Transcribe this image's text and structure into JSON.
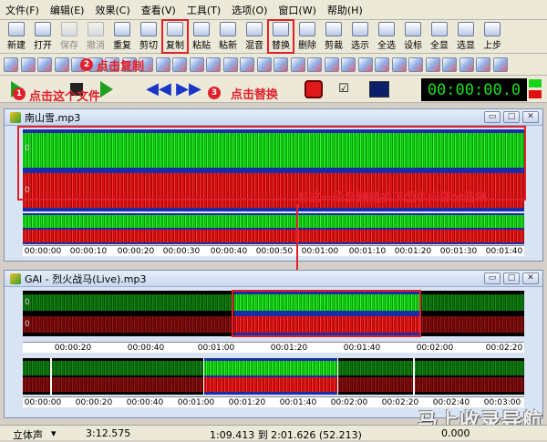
{
  "menu": [
    "文件(F)",
    "编辑(E)",
    "效果(C)",
    "查看(V)",
    "工具(T)",
    "选项(O)",
    "窗口(W)",
    "帮助(H)"
  ],
  "toolbar": [
    {
      "label": "新建",
      "icon": "new-file-icon",
      "disabled": false
    },
    {
      "label": "打开",
      "icon": "open-folder-icon",
      "disabled": false
    },
    {
      "label": "保存",
      "icon": "save-icon",
      "disabled": true
    },
    {
      "label": "撤消",
      "icon": "undo-icon",
      "disabled": true
    },
    {
      "label": "重复",
      "icon": "redo-icon",
      "disabled": false
    },
    {
      "label": "剪切",
      "icon": "cut-icon",
      "disabled": false
    },
    {
      "label": "复制",
      "icon": "copy-icon",
      "disabled": false,
      "highlight": true
    },
    {
      "label": "粘贴",
      "icon": "paste-icon",
      "disabled": false
    },
    {
      "label": "粘新",
      "icon": "paste-new-icon",
      "disabled": false
    },
    {
      "label": "混音",
      "icon": "mix-icon",
      "disabled": false
    },
    {
      "label": "替换",
      "icon": "replace-icon",
      "disabled": false,
      "highlight": true
    },
    {
      "label": "删除",
      "icon": "delete-icon",
      "disabled": false
    },
    {
      "label": "剪裁",
      "icon": "trim-icon",
      "disabled": false
    },
    {
      "label": "选示",
      "icon": "show-selection-icon",
      "disabled": false
    },
    {
      "label": "全选",
      "icon": "select-all-icon",
      "disabled": false
    },
    {
      "label": "设标",
      "icon": "set-marker-icon",
      "disabled": false
    },
    {
      "label": "全显",
      "icon": "zoom-all-icon",
      "disabled": false
    },
    {
      "label": "选显",
      "icon": "zoom-selection-icon",
      "disabled": false
    },
    {
      "label": "上步",
      "icon": "previous-step-icon",
      "disabled": false
    }
  ],
  "callouts": {
    "step1": "点击这个文件",
    "step2": "点击复制",
    "step3": "点击替换",
    "note": "有这一段音频替换下面中间部分音频",
    "n1": "1",
    "n2": "2",
    "n3": "3"
  },
  "timer": "00:00:00.0",
  "window1": {
    "title": "南山雪.mp3",
    "channel_labels": [
      "0",
      "0"
    ],
    "overview_ticks": [
      "00:00:00",
      "00:00:10",
      "00:00:20",
      "00:00:30",
      "00:00:40",
      "00:00:50",
      "00:01:00",
      "00:01:10",
      "00:01:20",
      "00:01:30",
      "00:01:40"
    ]
  },
  "window2": {
    "title": "GAI - 烈火战马(Live).mp3",
    "channel_labels": [
      "0",
      "0"
    ],
    "detail_ticks": [
      "00:00:20",
      "00:00:40",
      "00:01:00",
      "00:01:20",
      "00:01:40",
      "00:02:00",
      "00:02:20"
    ],
    "overview_ticks": [
      "00:00:00",
      "00:00:20",
      "00:00:40",
      "00:01:00",
      "00:01:20",
      "00:01:40",
      "00:02:00",
      "00:02:20",
      "00:02:40",
      "00:03:00"
    ]
  },
  "status": {
    "channel": "立体声",
    "length": "3:12.575",
    "selection": "1:09.413 到 2:01.626 (52.213)",
    "value": "0.000"
  },
  "watermark": "马上收录导航",
  "colors": {
    "accent_red": "#e0202a",
    "wave_green": "#19d419",
    "wave_red": "#e01010",
    "timer_green": "#19e019"
  }
}
